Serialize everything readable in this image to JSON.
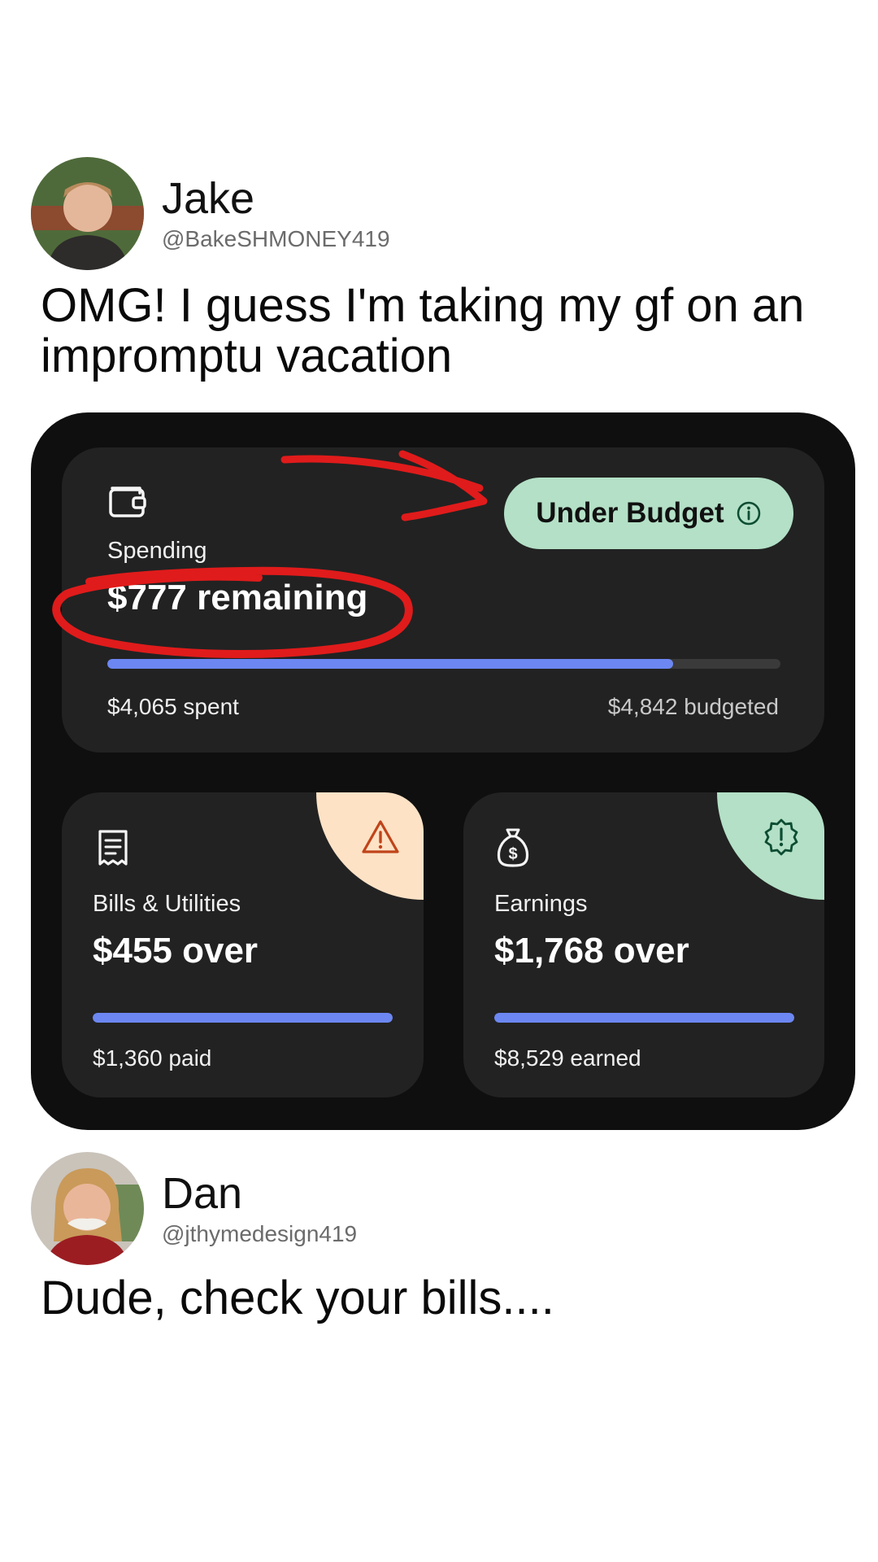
{
  "post1": {
    "name": "Jake",
    "handle": "@BakeSHMONEY419",
    "text": "OMG! I guess I'm taking my gf on an impromptu vacation"
  },
  "budget": {
    "spending": {
      "icon": "wallet-icon",
      "label": "Spending",
      "headline": "$777 remaining",
      "spent": "$4,065 spent",
      "budgeted": "$4,842 budgeted",
      "progress": 0.84,
      "badge": "Under Budget",
      "badge_icon": "info-icon",
      "badge_color": "#b3e0c6"
    },
    "bills": {
      "icon": "receipt-icon",
      "corner_icon": "warning-icon",
      "corner_color": "#fde2c6",
      "label": "Bills & Utilities",
      "headline": "$455 over",
      "sub": "$1,360 paid",
      "progress": 1.0
    },
    "earnings": {
      "icon": "money-bag-icon",
      "corner_icon": "alert-badge-icon",
      "corner_color": "#b3e0c6",
      "label": "Earnings",
      "headline": "$1,768 over",
      "sub": "$8,529 earned",
      "progress": 1.0
    },
    "accent_color": "#6c87f2",
    "annotation_color": "#e01b1b"
  },
  "post2": {
    "name": "Dan",
    "handle": "@jthymedesign419",
    "text": "Dude, check your bills...."
  }
}
